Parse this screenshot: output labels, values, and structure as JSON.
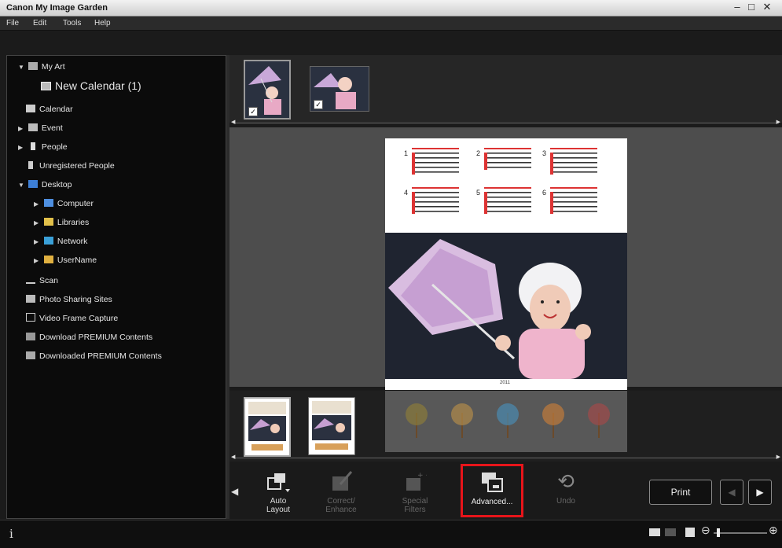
{
  "window": {
    "title": "Canon My Image Garden",
    "minimize_icon": "minimize-icon",
    "maximize_icon": "maximize-icon",
    "close_icon": "close-icon"
  },
  "menu": [
    "File",
    "Edit",
    "Tools",
    "Help"
  ],
  "sidebar": {
    "items": [
      {
        "label": "My Art",
        "icon": "paintbrush-icon",
        "arrow": "▼"
      },
      {
        "label": "New Calendar (1)",
        "icon": "calendar-project-icon",
        "arrow": ""
      },
      {
        "label": "Calendar",
        "icon": "calendar-icon",
        "arrow": ""
      },
      {
        "label": "Event",
        "icon": "event-icon",
        "arrow": "▶"
      },
      {
        "label": "People",
        "icon": "person-icon",
        "arrow": "▶"
      },
      {
        "label": "Unregistered People",
        "icon": "unregistered-person-icon",
        "arrow": ""
      },
      {
        "label": "Desktop",
        "icon": "desktop-icon",
        "arrow": "▼"
      },
      {
        "label": "Computer",
        "icon": "computer-icon",
        "arrow": "▶"
      },
      {
        "label": "Libraries",
        "icon": "libraries-icon",
        "arrow": "▶"
      },
      {
        "label": "Network",
        "icon": "network-icon",
        "arrow": "▶"
      },
      {
        "label": "UserName",
        "icon": "user-folder-icon",
        "arrow": "▶"
      },
      {
        "label": "Scan",
        "icon": "scan-icon",
        "arrow": ""
      },
      {
        "label": "Photo Sharing Sites",
        "icon": "photo-sharing-icon",
        "arrow": ""
      },
      {
        "label": "Video Frame Capture",
        "icon": "video-capture-icon",
        "arrow": ""
      },
      {
        "label": "Download PREMIUM Contents",
        "icon": "download-icon",
        "arrow": ""
      },
      {
        "label": "Downloaded PREMIUM Contents",
        "icon": "folder-icon",
        "arrow": ""
      }
    ]
  },
  "calendar_preview": {
    "month_numbers": [
      "1",
      "2",
      "3",
      "4",
      "5",
      "6"
    ],
    "year_label": "2011"
  },
  "toolbar": {
    "auto_layout": "Auto\nLayout",
    "correct_enhance": "Correct/\nEnhance",
    "special_filters": "Special\nFilters",
    "advanced": "Advanced...",
    "undo": "Undo",
    "print": "Print"
  },
  "status": {
    "info": "i"
  },
  "colors": {
    "highlight": "#e8141a",
    "window_bg": "#1b1b1b",
    "canvas_bg": "#4d4d4d"
  }
}
